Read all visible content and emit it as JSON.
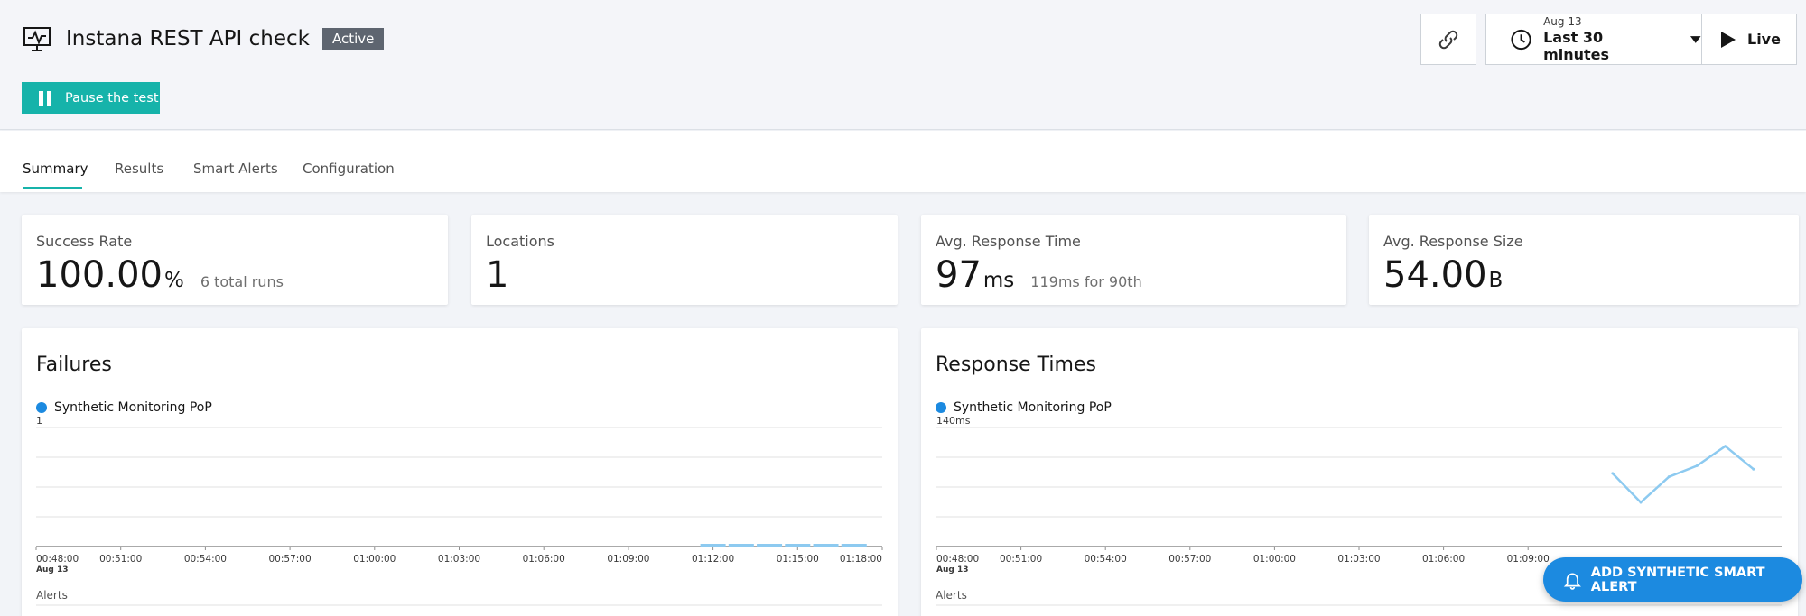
{
  "header": {
    "title": "Instana REST API check",
    "status": "Active",
    "pause_label": "Pause the test",
    "title_icon": "monitor-pulse-icon"
  },
  "controls": {
    "link_icon": "link-icon",
    "time_date": "Aug 13",
    "time_range": "Last 30 minutes",
    "live_label": "Live"
  },
  "tabs": [
    {
      "label": "Summary",
      "active": true
    },
    {
      "label": "Results"
    },
    {
      "label": "Smart Alerts"
    },
    {
      "label": "Configuration"
    }
  ],
  "kpis": [
    {
      "label": "Success Rate",
      "value": "100.00",
      "unit": "%",
      "sub": "6 total runs"
    },
    {
      "label": "Locations",
      "value": "1",
      "unit": "",
      "sub": ""
    },
    {
      "label": "Avg. Response Time",
      "value": "97",
      "unit": "ms",
      "sub": "119ms for 90th"
    },
    {
      "label": "Avg. Response Size",
      "value": "54.00",
      "unit": "B",
      "sub": ""
    }
  ],
  "charts": {
    "failures": {
      "title": "Failures",
      "legend": "Synthetic Monitoring PoP",
      "ymax_label": "1",
      "alerts_label": "Alerts"
    },
    "response_times": {
      "title": "Response Times",
      "legend": "Synthetic Monitoring PoP",
      "ymax_label": "140ms",
      "alerts_label": "Alerts"
    }
  },
  "fab": {
    "label": "ADD SYNTHETIC SMART ALERT",
    "icon": "bell-icon"
  },
  "colors": {
    "accent": "#16b3aa",
    "series": "#1c8ae0",
    "series_line": "#8dcaf0",
    "badge": "#5e6570"
  },
  "chart_data": [
    {
      "type": "bar",
      "title": "Failures",
      "series": [
        {
          "name": "Synthetic Monitoring PoP",
          "values": [
            0,
            0,
            0,
            0,
            0,
            0
          ]
        }
      ],
      "x": [
        "01:12:00",
        "01:13:00",
        "01:14:00",
        "01:15:00",
        "01:16:00",
        "01:17:00"
      ],
      "x_ticks": [
        "00:48:00",
        "00:51:00",
        "00:54:00",
        "00:57:00",
        "01:00:00",
        "01:03:00",
        "01:06:00",
        "01:09:00",
        "01:12:00",
        "01:15:00",
        "01:18:00"
      ],
      "x_tick_sublabel": "Aug 13",
      "ylim": [
        0,
        1
      ],
      "y_label_top": "1",
      "grid": true
    },
    {
      "type": "line",
      "title": "Response Times",
      "series": [
        {
          "name": "Synthetic Monitoring PoP",
          "values": [
            86,
            52,
            82,
            95,
            118,
            91
          ]
        }
      ],
      "x": [
        "01:12:00",
        "01:13:00",
        "01:14:00",
        "01:15:00",
        "01:16:00",
        "01:17:00"
      ],
      "x_ticks": [
        "00:48:00",
        "00:51:00",
        "00:54:00",
        "00:57:00",
        "01:00:00",
        "01:03:00",
        "01:06:00",
        "01:09:00"
      ],
      "x_tick_sublabel": "Aug 13",
      "ylim": [
        0,
        140
      ],
      "y_label_top": "140ms",
      "grid": true
    }
  ]
}
